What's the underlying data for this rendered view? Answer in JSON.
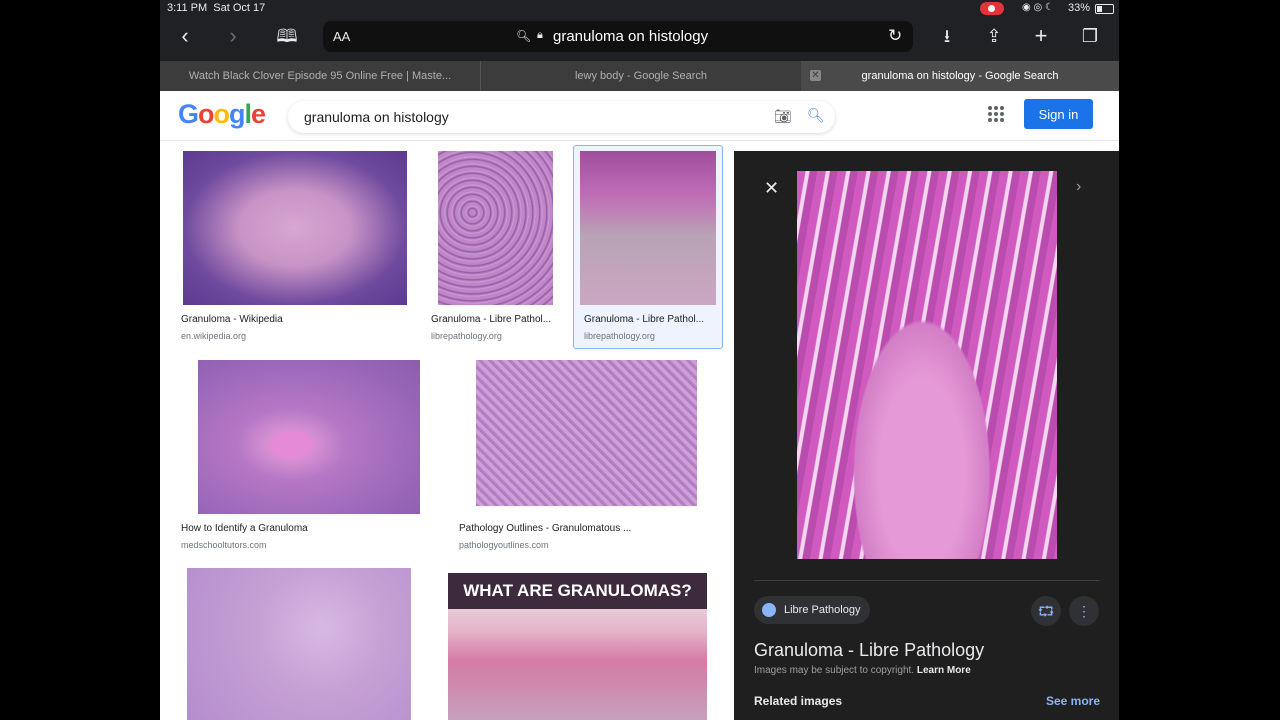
{
  "status": {
    "time": "3:11 PM",
    "date": "Sat Oct 17",
    "battery": "33%"
  },
  "toolbar": {
    "text_size": "AA",
    "url": "granuloma on histology"
  },
  "tabs": [
    {
      "title": "Watch Black Clover Episode 95 Online Free | Maste..."
    },
    {
      "title": "lewy body - Google Search"
    },
    {
      "title": "granuloma on histology - Google Search"
    }
  ],
  "google": {
    "logo": "Google",
    "query": "granuloma on histology",
    "signin": "Sign in"
  },
  "results": [
    {
      "title": "Granuloma - Wikipedia",
      "source": "en.wikipedia.org"
    },
    {
      "title": "Granuloma - Libre Pathol...",
      "source": "librepathology.org"
    },
    {
      "title": "Granuloma - Libre Pathol...",
      "source": "librepathology.org"
    },
    {
      "title": "How to Identify a Granuloma",
      "source": "medschooltutors.com"
    },
    {
      "title": "Pathology Outlines - Granulomatous ...",
      "source": "pathologyoutlines.com"
    }
  ],
  "banner": "WHAT ARE GRANULOMAS?",
  "panel": {
    "site": "Libre Pathology",
    "title": "Granuloma - Libre Pathology",
    "copyright": "Images may be subject to copyright.",
    "learn_more": "Learn More",
    "related": "Related images",
    "see_more": "See more"
  },
  "colors": {
    "accent": "#1a73e8",
    "panel_bg": "#1f1f1f",
    "chrome_bg": "#202124"
  }
}
